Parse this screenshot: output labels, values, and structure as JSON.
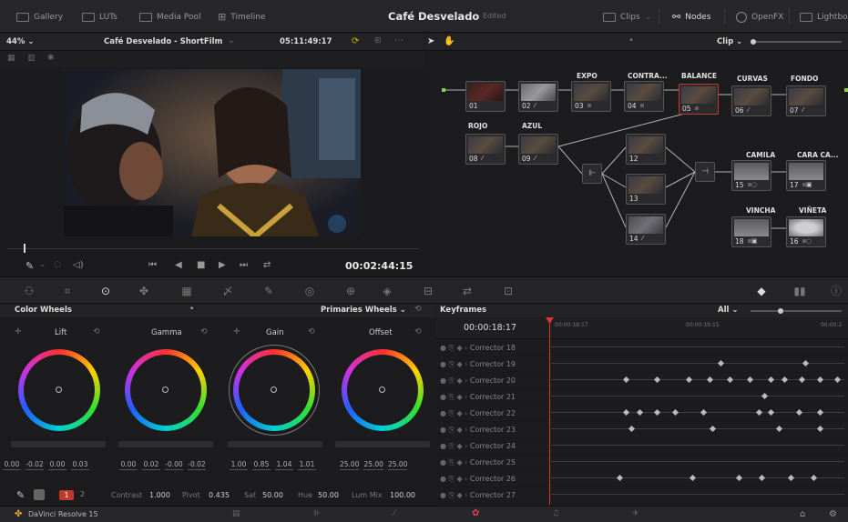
{
  "topbar": {
    "gallery": "Gallery",
    "luts": "LUTs",
    "media_pool": "Media Pool",
    "timeline": "Timeline",
    "project_title": "Café Desvelado",
    "project_status": "Edited",
    "clips": "Clips",
    "nodes": "Nodes",
    "openfx": "OpenFX",
    "lightbox": "Lightbox"
  },
  "viewer": {
    "zoom": "44%",
    "timeline_name": "Café Desvelado - ShortFilm",
    "timecode_top": "05:11:49:17",
    "timecode": "00:02:44:15"
  },
  "nodes": {
    "mode": "Clip",
    "labels": {
      "expo": "EXPO",
      "contra": "CONTRA...",
      "balance": "BALANCE",
      "curvas": "CURVAS",
      "fondo": "FONDO",
      "rojo": "ROJO",
      "azul": "AZUL",
      "camila": "CAMILA",
      "cara": "CARA CA...",
      "vincha": "VINCHA",
      "vineta": "VIÑETA"
    },
    "numbers": {
      "n01": "01",
      "n02": "02",
      "n03": "03",
      "n04": "04",
      "n05": "05",
      "n06": "06",
      "n07": "07",
      "n08": "08",
      "n09": "09",
      "n12": "12",
      "n13": "13",
      "n14": "14",
      "n15": "15",
      "n16": "16",
      "n17": "17",
      "n18": "18"
    }
  },
  "color_wheels": {
    "panel_title": "Color Wheels",
    "mode": "Primaries Wheels",
    "lift": {
      "label": "Lift",
      "values": [
        "0.00",
        "-0.02",
        "0.00",
        "0.03"
      ]
    },
    "gamma": {
      "label": "Gamma",
      "values": [
        "0.00",
        "0.02",
        "-0.00",
        "-0.02"
      ]
    },
    "gain": {
      "label": "Gain",
      "values": [
        "1.00",
        "0.85",
        "1.04",
        "1.01"
      ]
    },
    "offset": {
      "label": "Offset",
      "values": [
        "25.00",
        "25.00",
        "25.00"
      ]
    },
    "page_1": "1",
    "page_2": "2",
    "contrast_label": "Contrast",
    "contrast_value": "1.000",
    "pivot_label": "Pivot",
    "pivot_value": "0.435",
    "sat_label": "Sat",
    "sat_value": "50.00",
    "hue_label": "Hue",
    "hue_value": "50.00",
    "lummix_label": "Lum Mix",
    "lummix_value": "100.00"
  },
  "keyframes": {
    "panel_title": "Keyframes",
    "filter": "All",
    "current_tc": "00:00:18:17",
    "ruler": [
      "00:00:18:17",
      "00:00:19:15",
      "00:00:2"
    ],
    "rows": [
      {
        "name": "Corrector 18",
        "dots": []
      },
      {
        "name": "Corrector 19",
        "dots": [
          0.58,
          0.87
        ]
      },
      {
        "name": "Corrector 20",
        "dots": [
          0.25,
          0.36,
          0.47,
          0.54,
          0.61,
          0.68,
          0.75,
          0.8,
          0.86,
          0.92,
          0.98
        ]
      },
      {
        "name": "Corrector 21",
        "dots": [
          0.73
        ]
      },
      {
        "name": "Corrector 22",
        "dots": [
          0.25,
          0.3,
          0.36,
          0.42,
          0.52,
          0.71,
          0.75,
          0.85,
          0.92
        ]
      },
      {
        "name": "Corrector 23",
        "dots": [
          0.27,
          0.55,
          0.78,
          0.92
        ]
      },
      {
        "name": "Corrector 24",
        "dots": []
      },
      {
        "name": "Corrector 25",
        "dots": []
      },
      {
        "name": "Corrector 26",
        "dots": [
          0.23,
          0.48,
          0.64,
          0.72,
          0.82,
          0.9
        ]
      },
      {
        "name": "Corrector 27",
        "dots": []
      }
    ]
  },
  "status": {
    "app_name": "DaVinci Resolve 15"
  }
}
